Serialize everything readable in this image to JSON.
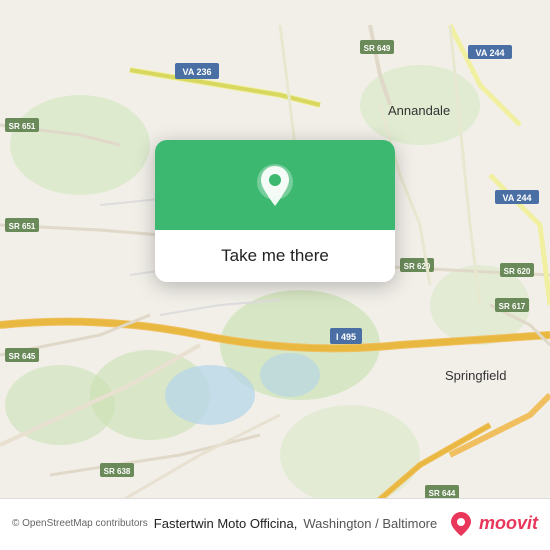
{
  "map": {
    "background_color": "#f2efe9",
    "center_lat": 38.82,
    "center_lon": -77.18
  },
  "cta": {
    "button_label": "Take me there",
    "icon_name": "location-pin-icon"
  },
  "info_bar": {
    "copyright": "© OpenStreetMap contributors",
    "place_name": "Fastertwin Moto Officina,",
    "region": "Washington / Baltimore"
  },
  "moovit": {
    "logo_text": "moovit"
  }
}
